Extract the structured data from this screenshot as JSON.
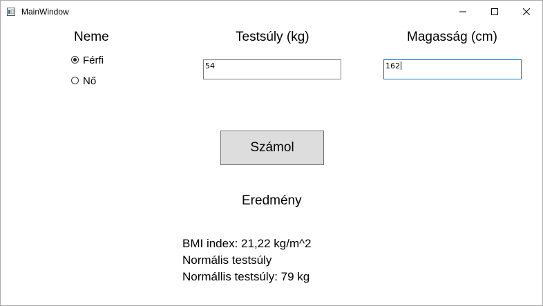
{
  "window": {
    "title": "MainWindow",
    "icons": {
      "app": "window-app-icon",
      "minimize": "minimize-icon",
      "maximize": "maximize-icon",
      "close": "close-icon"
    }
  },
  "form": {
    "gender_label": "Neme",
    "gender_options": [
      {
        "label": "Férfi",
        "checked": true
      },
      {
        "label": "Nő",
        "checked": false
      }
    ],
    "weight_label": "Testsúly (kg)",
    "weight_value": "54",
    "height_label": "Magasság (cm)",
    "height_value": "162",
    "calculate_button": "Számol"
  },
  "result": {
    "heading": "Eredmény",
    "bmi_line": "BMI index: 21,22 kg/m^2",
    "category_line": "Normális testsúly",
    "ideal_weight_line": "Normállis testsúly: 79 kg"
  },
  "colors": {
    "button_bg": "#dddddd",
    "focus_border": "#0078d7",
    "input_border": "#7a7a7a"
  }
}
